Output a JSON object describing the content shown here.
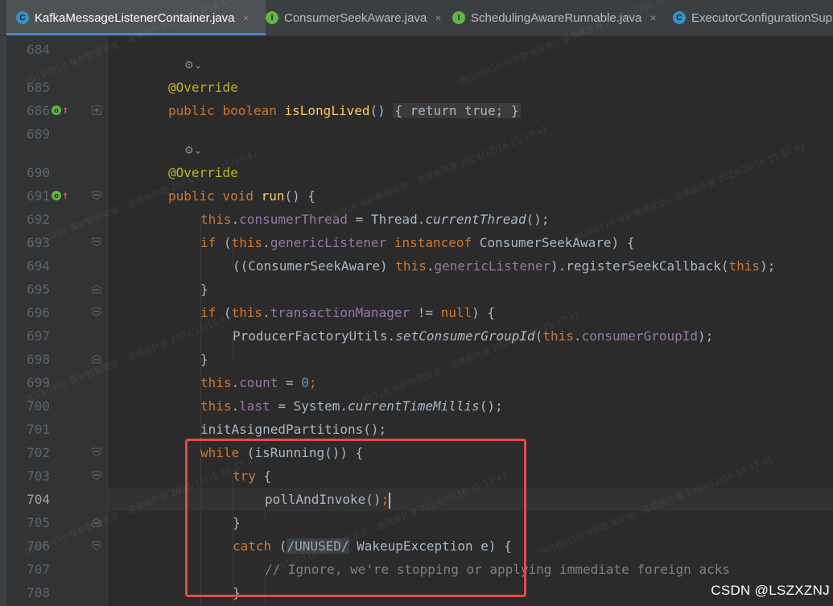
{
  "tabs": [
    {
      "label": "KafkaMessageListenerContainer.java",
      "icon": "class-file-icon",
      "icon_letter": "C",
      "active": true,
      "close": "×"
    },
    {
      "label": "ConsumerSeekAware.java",
      "icon": "interface-file-icon",
      "icon_letter": "I",
      "active": false,
      "close": "×"
    },
    {
      "label": "SchedulingAwareRunnable.java",
      "icon": "interface-file-icon",
      "icon_letter": "I",
      "active": false,
      "close": "×"
    },
    {
      "label": "ExecutorConfigurationSup",
      "icon": "class-file-icon",
      "icon_letter": "C",
      "active": false,
      "close": ""
    }
  ],
  "line_numbers": [
    "684",
    "685",
    "686",
    "689",
    "690",
    "691",
    "692",
    "693",
    "694",
    "695",
    "696",
    "697",
    "698",
    "699",
    "700",
    "701",
    "702",
    "703",
    "704",
    "705",
    "706",
    "707",
    "708"
  ],
  "current_line": "704",
  "inlay_hint": "⚙⌄",
  "code": {
    "override": "@Override",
    "l686": {
      "pub": "public",
      "bool": "boolean",
      "name": "isLongLived",
      "paren": "()",
      "body": "{ return true; }"
    },
    "l691": {
      "pub": "public",
      "void": "void",
      "name": "run",
      "rest": "() {"
    },
    "l692": {
      "this": "this",
      "dot": ".",
      "field": "consumerThread",
      "eq": " = Thread.",
      "call": "currentThread",
      "end": "();"
    },
    "l693": {
      "if": "if",
      "open": " (",
      "this": "this",
      "dot": ".",
      "field": "genericListener",
      "sp": " ",
      "inst": "instanceof",
      "rest": " ConsumerSeekAware) {"
    },
    "l694": {
      "pre": "((ConsumerSeekAware) ",
      "this": "this",
      "dot": ".",
      "field": "genericListener",
      "mid": ").registerSeekCallback(",
      "this2": "this",
      "end": ");"
    },
    "l695": "}",
    "l696": {
      "if": "if",
      "open": " (",
      "this": "this",
      "dot": ".",
      "field": "transactionManager",
      "ne": " != ",
      "null": "null",
      "end": ") {"
    },
    "l697": {
      "pre": "ProducerFactoryUtils.",
      "call": "setConsumerGroupId",
      "open": "(",
      "this": "this",
      "dot": ".",
      "field": "consumerGroupId",
      "end": ");"
    },
    "l698": "}",
    "l699": {
      "this": "this",
      "dot": ".",
      "field": "count",
      "eq": " = ",
      "num": "0",
      "end": ";"
    },
    "l700": {
      "this": "this",
      "dot": ".",
      "field": "last",
      "eq": " = System.",
      "call": "currentTimeMillis",
      "end": "();"
    },
    "l701": "initAsignedPartitions();",
    "l702": {
      "while": "while",
      "rest": " (isRunning()) {"
    },
    "l703": {
      "try": "try",
      "rest": " {"
    },
    "l704": {
      "call": "pollAndInvoke()",
      "semi": ";"
    },
    "l705": "}",
    "l706": {
      "catch": "catch",
      "open": " (",
      "unused": "/UNUSED/",
      "rest": " WakeupException e) {"
    },
    "l707": "// Ignore, we're stopping or applying immediate foreign acks",
    "l708": "}"
  },
  "watermark_lines": [
    "00180310",
    "保护数据安全，谨慎偷外发",
    "2024/12/16 15:17:41"
  ],
  "credit": "CSDN @LSZXZNJ",
  "colors": {
    "accent": "#4a88c7",
    "highlight_box": "#e5484d",
    "keyword": "#cc7832",
    "annotation": "#bbb529",
    "method": "#ffc66d",
    "field": "#9876aa",
    "number": "#6897bb"
  }
}
